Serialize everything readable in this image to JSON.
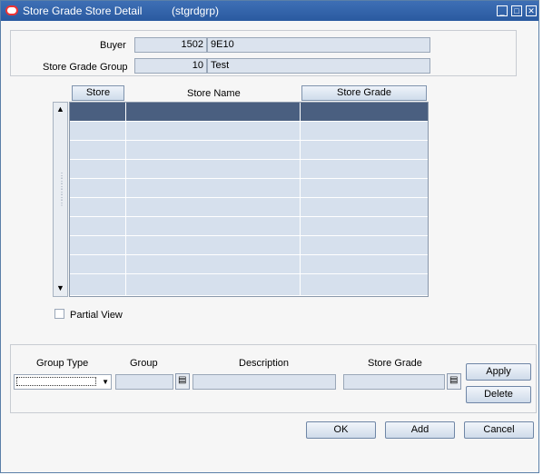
{
  "window": {
    "title": "Store Grade Store Detail",
    "form_code": "(stgrdgrp)"
  },
  "header": {
    "buyer_label": "Buyer",
    "buyer_id": "1502",
    "buyer_name": "9E10",
    "group_label": "Store Grade Group",
    "group_id": "10",
    "group_name": "Test"
  },
  "grid": {
    "columns": {
      "store": "Store",
      "store_name": "Store Name",
      "store_grade": "Store Grade"
    },
    "row_count": 10
  },
  "partial_view_label": "Partial View",
  "filter": {
    "group_type_label": "Group Type",
    "group_label": "Group",
    "description_label": "Description",
    "store_grade_label": "Store Grade",
    "apply_label": "Apply",
    "delete_label": "Delete"
  },
  "footer": {
    "ok_label": "OK",
    "add_label": "Add",
    "cancel_label": "Cancel"
  }
}
